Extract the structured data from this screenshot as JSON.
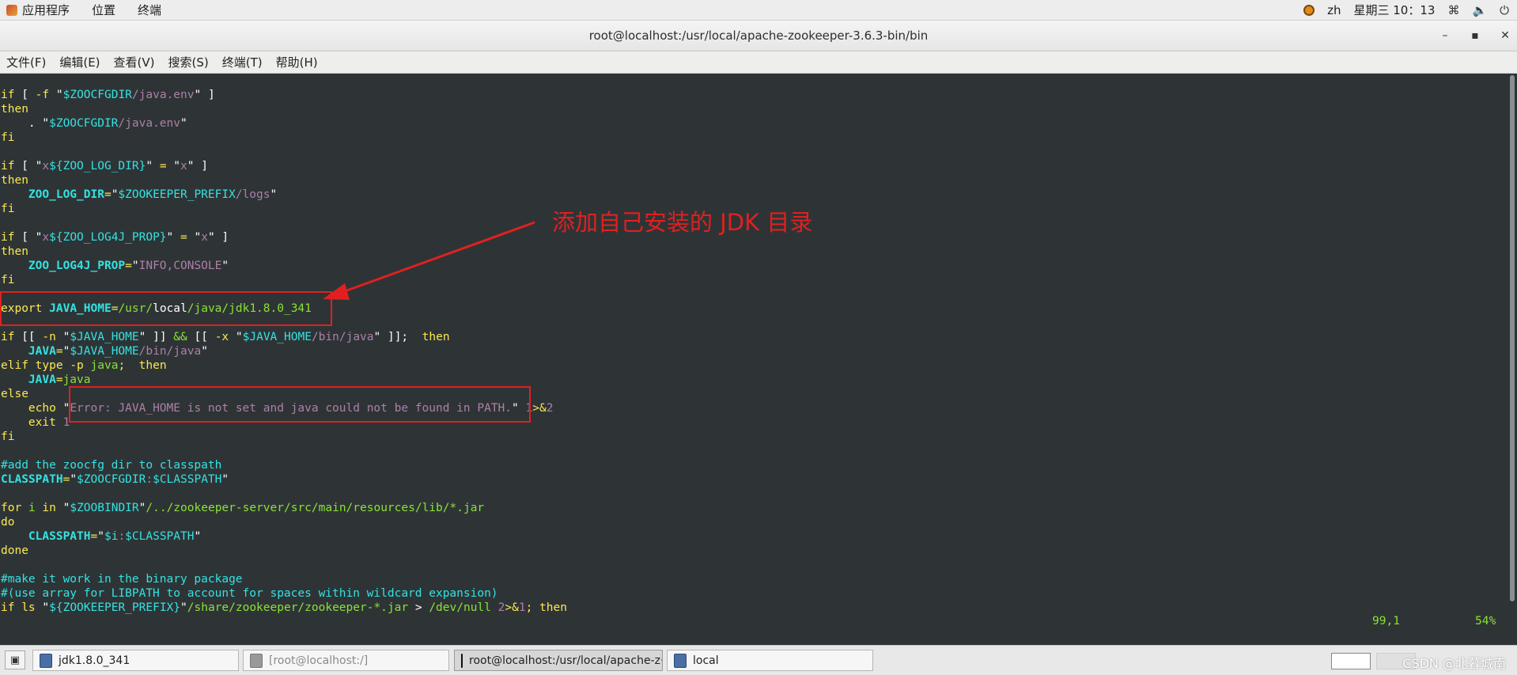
{
  "top_panel": {
    "apps_label": "应用程序",
    "places_label": "位置",
    "terminal_label": "终端",
    "lang": "zh",
    "clock": "星期三 10：13"
  },
  "window": {
    "title": "root@localhost:/usr/local/apache-zookeeper-3.6.3-bin/bin",
    "minimize_glyph": "–",
    "maximize_glyph": "▪",
    "close_glyph": "✕"
  },
  "menubar": {
    "items": [
      "文件(F)",
      "编辑(E)",
      "查看(V)",
      "搜索(S)",
      "终端(T)",
      "帮助(H)"
    ]
  },
  "terminal": {
    "status_position": "99,1",
    "status_percent": "54%"
  },
  "annotation": {
    "text": "添加自己安装的 JDK 目录",
    "color": "#e02020"
  },
  "taskbar": {
    "tasks": [
      {
        "label": "jdk1.8.0_341"
      },
      {
        "label": "[root@localhost:/]"
      },
      {
        "label": "root@localhost:/usr/local/apache-z···"
      },
      {
        "label": "local"
      }
    ],
    "watermark": "CSDN @北暮城南"
  },
  "colors": {
    "terminal_bg": "#2e3436",
    "keyword": "#fce94f",
    "variable": "#34e2e2",
    "string": "#ad7fa8",
    "path": "#8ae234"
  }
}
